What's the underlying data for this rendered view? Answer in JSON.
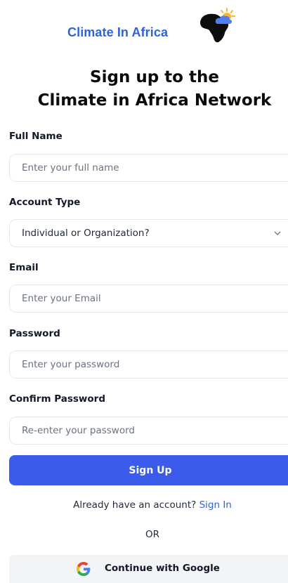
{
  "brand": {
    "name": "Climate In Africa",
    "color": "#2f63d8",
    "logo_icon": "africa-cloud-sun-icon"
  },
  "heading": {
    "line1": "Sign up to the",
    "line2": "Climate in Africa Network"
  },
  "form": {
    "full_name": {
      "label": "Full Name",
      "placeholder": "Enter your full name",
      "value": ""
    },
    "account_type": {
      "label": "Account Type",
      "selected": "Individual or Organization?",
      "icon": "chevron-down-icon"
    },
    "email": {
      "label": "Email",
      "placeholder": "Enter your Email",
      "value": ""
    },
    "password": {
      "label": "Password",
      "placeholder": "Enter your password",
      "value": ""
    },
    "confirm_password": {
      "label": "Confirm Password",
      "placeholder": "Re-enter your password",
      "value": ""
    }
  },
  "actions": {
    "signup_label": "Sign Up",
    "signup_color": "#3b5bea",
    "have_account_text": "Already have an account?",
    "signin_link": "Sign In",
    "or_text": "OR",
    "google_label": "Continue with Google",
    "google_icon": "google-icon"
  }
}
